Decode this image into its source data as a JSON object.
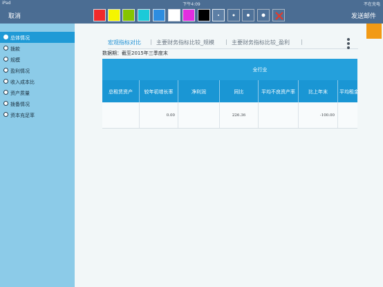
{
  "status_bar": {
    "device": "iPad",
    "wifi": "ᯤ",
    "time": "下午4:09",
    "battery": "不在充电"
  },
  "toolbar": {
    "cancel_label": "取消",
    "send_label": "发送邮件",
    "colors": [
      "#f02a2a",
      "#f5f500",
      "#86c400",
      "#1ccad8",
      "#2d8de0",
      "#ffffff",
      "#e22ee0",
      "#000000"
    ],
    "brush_sizes": [
      "small",
      "medium",
      "large",
      "xlarge"
    ],
    "close_icon": "close-icon"
  },
  "sidebar": {
    "items": [
      {
        "label": "总体情况"
      },
      {
        "label": "拨款"
      },
      {
        "label": "规模"
      },
      {
        "label": "盈利情况"
      },
      {
        "label": "收入成本比"
      },
      {
        "label": "资产质量"
      },
      {
        "label": "拨备情况"
      },
      {
        "label": "资本充足率"
      }
    ]
  },
  "tabs": [
    {
      "label": "宏观指标对比"
    },
    {
      "label": "主要财务指标比较_规模"
    },
    {
      "label": "主要财务指标比较_盈利"
    }
  ],
  "data_date": {
    "label": "数据期：",
    "value": "截至2015年三季度末"
  },
  "table": {
    "group_header": "全行业",
    "columns": [
      "总租赁资产",
      "较年初增长率",
      "净利润",
      "同比",
      "平均不良资产率",
      "比上年末",
      "平均租金"
    ],
    "row": [
      "",
      "0.00",
      "",
      "226.36",
      "",
      "-100.00",
      ""
    ]
  }
}
